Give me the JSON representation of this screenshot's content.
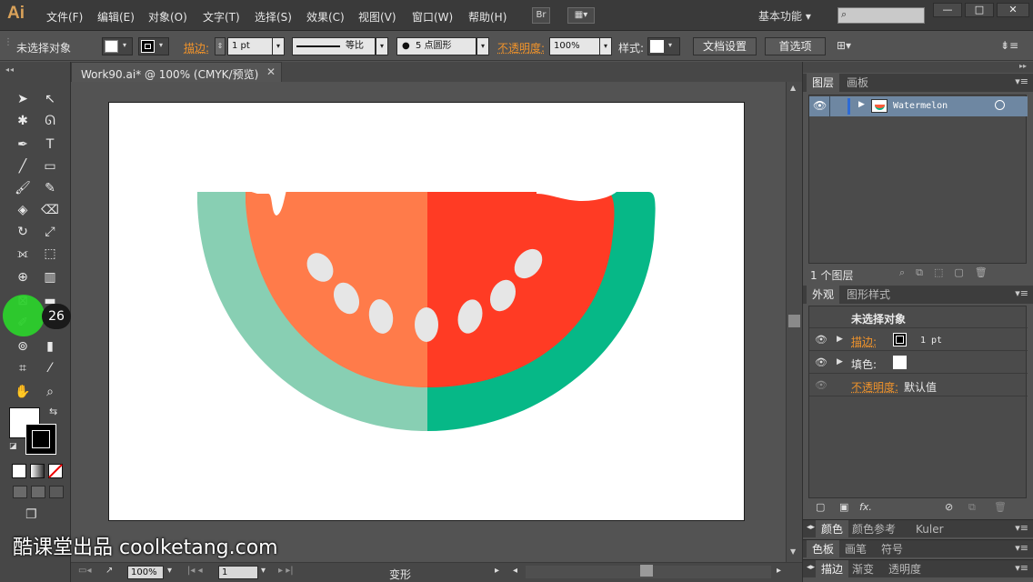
{
  "app": {
    "logo": "Ai"
  },
  "menu": [
    {
      "label": "文件(F)"
    },
    {
      "label": "编辑(E)"
    },
    {
      "label": "对象(O)"
    },
    {
      "label": "文字(T)"
    },
    {
      "label": "选择(S)"
    },
    {
      "label": "效果(C)"
    },
    {
      "label": "视图(V)"
    },
    {
      "label": "窗口(W)"
    },
    {
      "label": "帮助(H)"
    }
  ],
  "menubar": {
    "bridge_label": "Br",
    "workspace": "基本功能 ▾",
    "window_min": "—",
    "window_max": "□",
    "window_close": "✕"
  },
  "control": {
    "selection_status": "未选择对象",
    "stroke_label": "描边:",
    "stroke_weight": "1 pt",
    "profile_label": "等比",
    "brush_label": "5 点圆形",
    "opacity_label": "不透明度:",
    "opacity_value": "100%",
    "style_label": "样式:",
    "doc_setup_button": "文档设置",
    "preferences_button": "首选项"
  },
  "document": {
    "tab_title": "Work90.ai* @ 100% (CMYK/预览)",
    "close": "✕"
  },
  "cursor": {
    "badge": "26"
  },
  "status": {
    "zoom": "100%",
    "page": "1",
    "status_text": "变形"
  },
  "layers": {
    "tab_layers": "图层",
    "tab_artboards": "画板",
    "layer_name": "Watermelon",
    "count_text": "1 个图层"
  },
  "appearance": {
    "tab_appearance": "外观",
    "tab_graphic_styles": "图形样式",
    "header": "未选择对象",
    "stroke_label": "描边:",
    "stroke_value": "1 pt",
    "fill_label": "填色:",
    "opacity_label": "不透明度:",
    "opacity_value": "默认值",
    "fx_label": "fx."
  },
  "collapsed_panels": [
    {
      "tabs": [
        "颜色",
        "颜色参考",
        "Kuler"
      ]
    },
    {
      "tabs": [
        "色板",
        "画笔",
        "符号"
      ]
    },
    {
      "tabs": [
        "描边",
        "渐变",
        "透明度"
      ]
    }
  ],
  "watermark": "酷课堂出品 coolketang.com",
  "colors": {
    "rind_light": "#88cfb3",
    "rind_dark": "#06b887",
    "flesh_left": "#ff7b4a",
    "flesh_right": "#ff3b24",
    "seed": "#e6e6e6",
    "accent_orange": "#f0932b",
    "layer_highlight": "#6e87a2"
  }
}
